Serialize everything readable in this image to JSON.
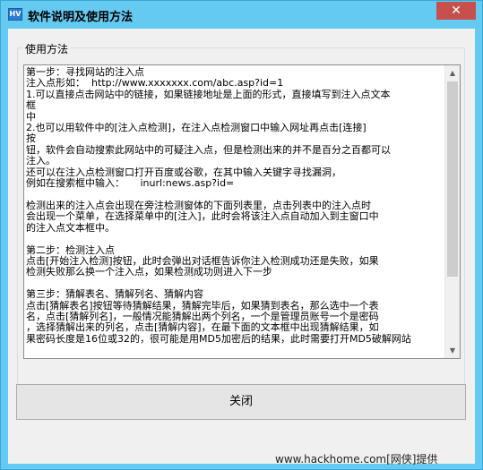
{
  "window": {
    "title": "软件说明及使用方法",
    "app_icon_text": "HV",
    "close_glyph": "✕"
  },
  "group": {
    "label": "使用方法"
  },
  "instructions": {
    "lines": [
      "第一步：寻找网站的注入点",
      "注入点形如：  http://www.xxxxxxx.com/abc.asp?id=1",
      "1.可以直接点击网站中的链接，如果链接地址是上面的形式，直接填写到注入点文本",
      "框",
      "中",
      "2.也可以用软件中的[注入点检测]，在注入点检测窗口中输入网址再点击[连接]",
      "按",
      "钮，软件会自动搜索此网站中的可疑注入点，但是检测出来的并不是百分之百都可以",
      "注入。",
      "还可以在注入点检测窗口打开百度或谷歌，在其中输入关键字寻找漏洞，",
      "例如在搜索框中输入：     inurl:news.asp?id=",
      "",
      "检测出来的注入点会出现在旁注检测窗体的下面列表里，点击列表中的注入点时",
      "会出现一个菜单，在选择菜单中的[注入]，此时会将该注入点自动加入到主窗口中",
      "的注入点文本框中。",
      "",
      "第二步：检测注入点",
      "点击[开始注入检测]按钮，此时会弹出对话框告诉你注入检测成功还是失败，如果",
      "检测失败那么换一个注入点，如果检测成功则进入下一步",
      "",
      "第三步：猜解表名、猜解列名、猜解内容",
      "点击[猜解表名]按钮等待猜解结果，猜解完毕后，如果猜到表名，那么选中一个表",
      "名，点击[猜解列名]，一般情况能猜解出两个列名，一个是管理员账号一个是密码",
      "，选择猜解出来的列名，点击[猜解内容]，在最下面的文本框中出现猜解结果，如",
      "果密码长度是16位或32的，很可能是用MD5加密后的结果，此时需要打开MD5破解网站"
    ]
  },
  "buttons": {
    "close_label": "关闭"
  },
  "footer": {
    "watermark": "www.hackhome.com[网侠]提供"
  },
  "colors": {
    "title_bar": "#64caf2",
    "close_button": "#c7504c",
    "client_bg": "#f0f0f0"
  }
}
